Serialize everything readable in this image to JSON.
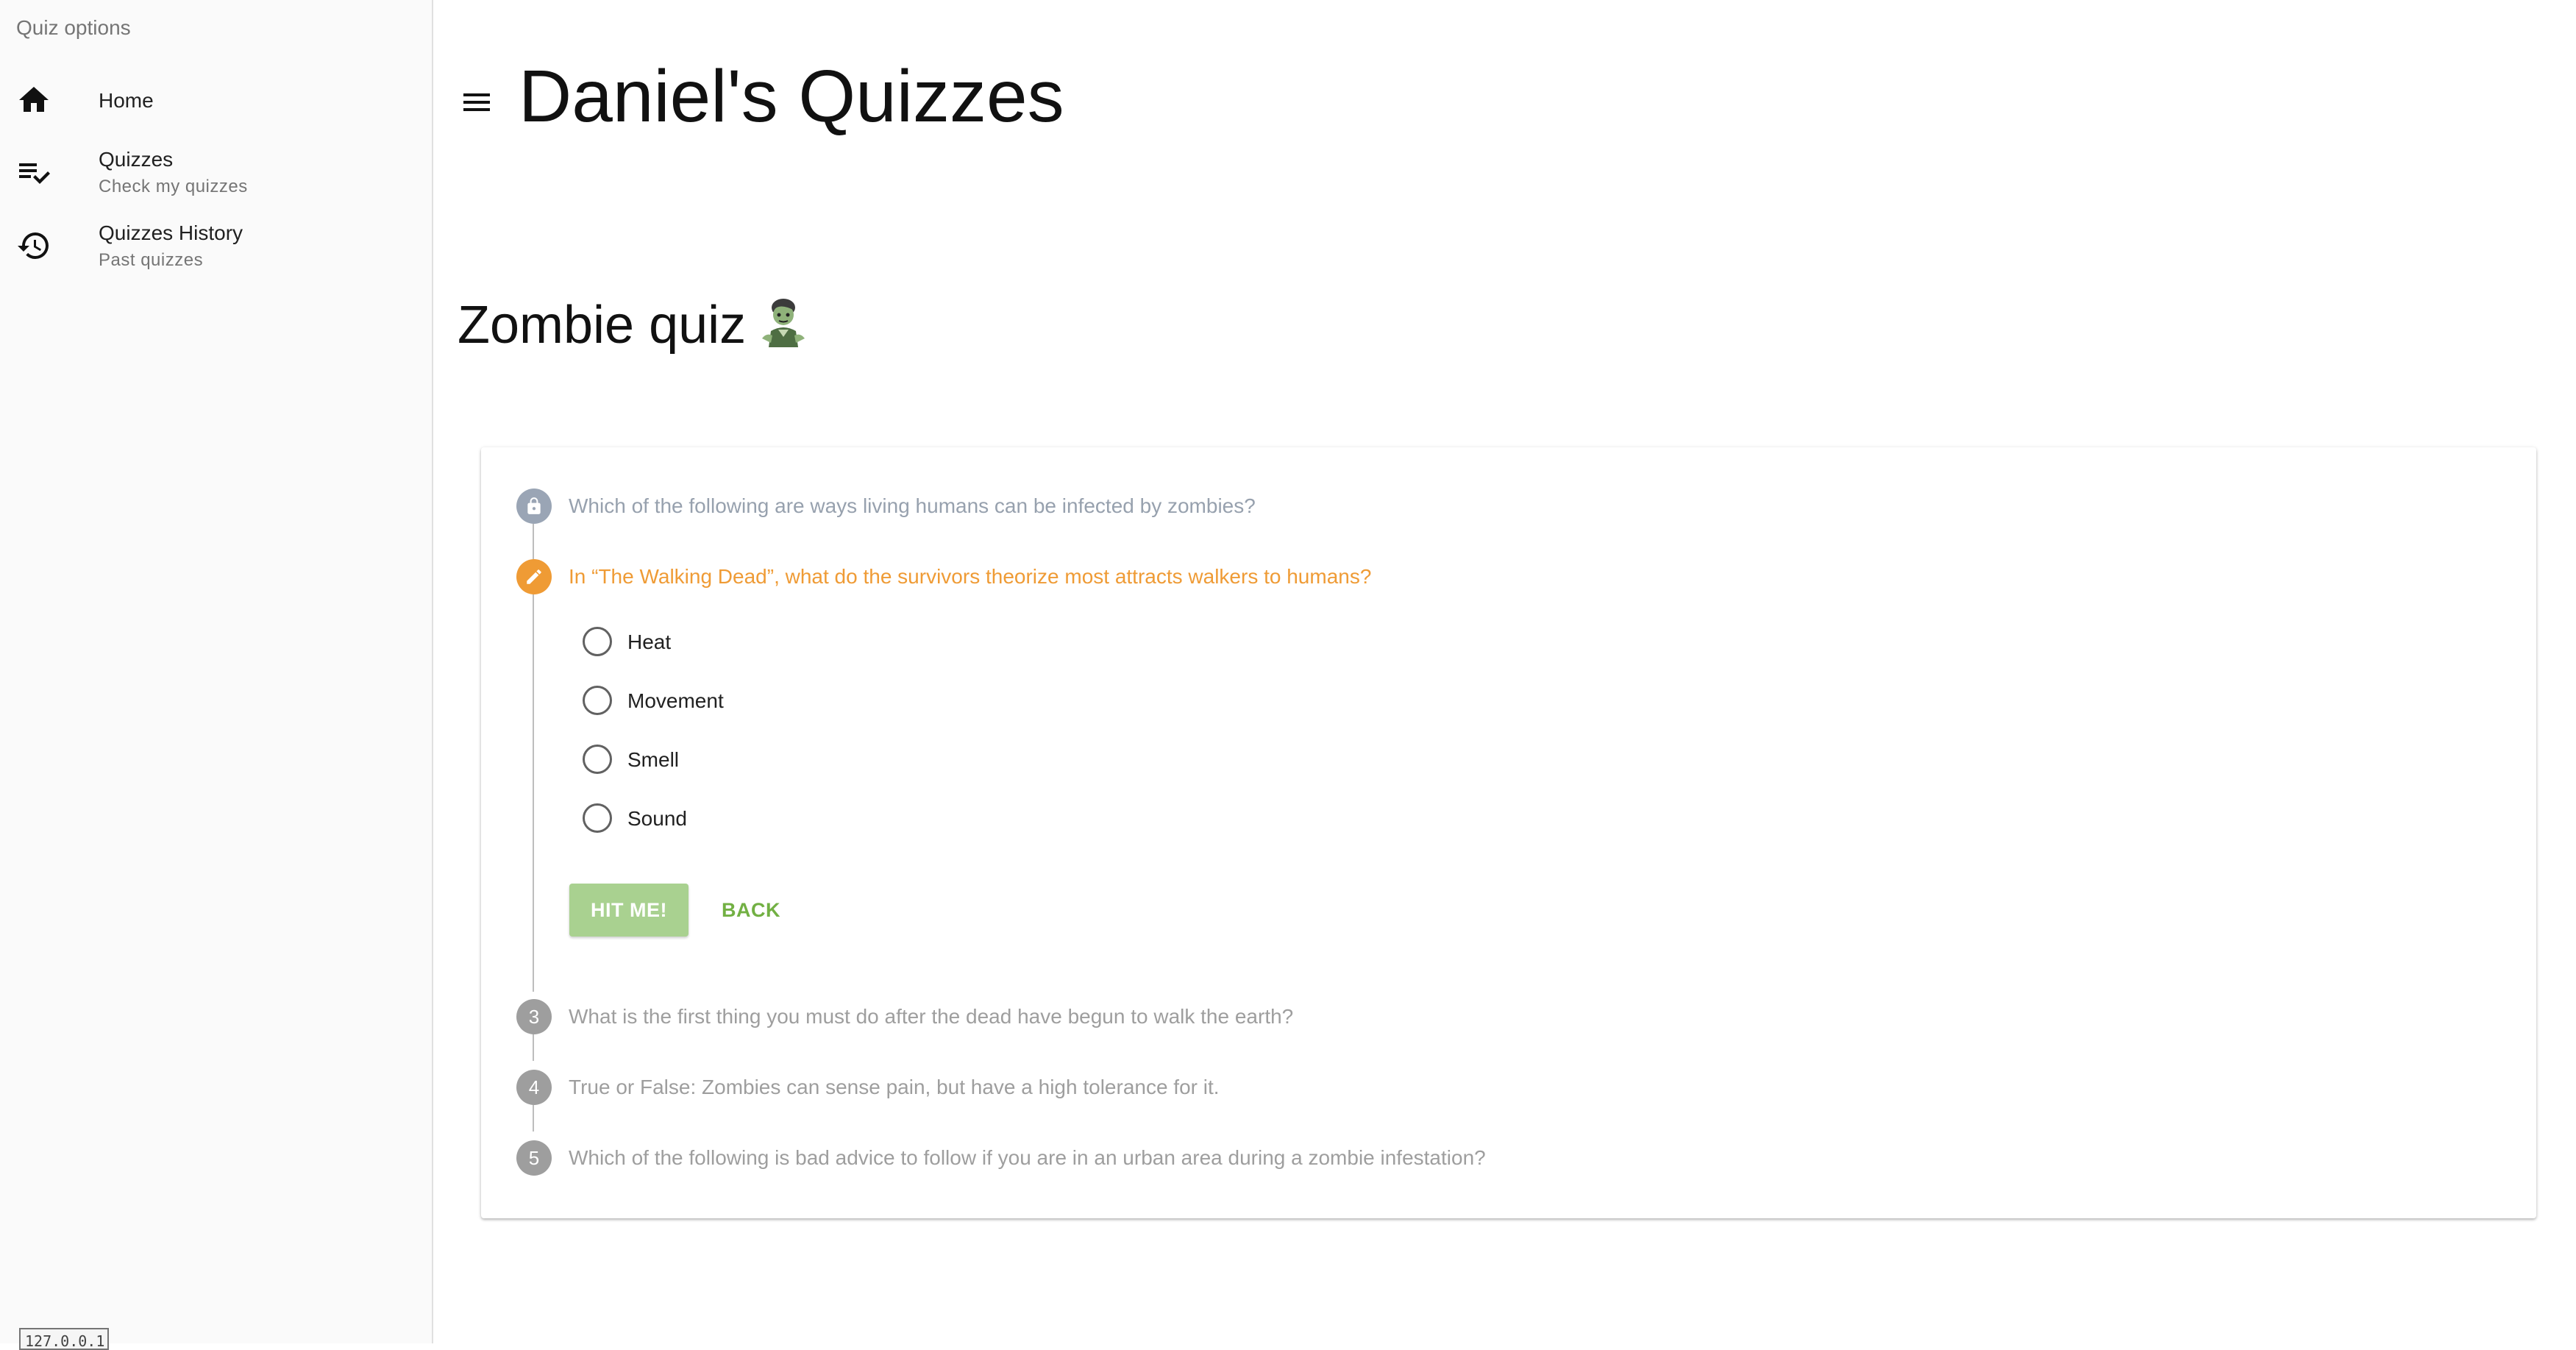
{
  "sidebar": {
    "header": "Quiz options",
    "items": [
      {
        "icon": "home-icon",
        "title": "Home",
        "subtitle": ""
      },
      {
        "icon": "playlist-check-icon",
        "title": "Quizzes",
        "subtitle": "Check my quizzes"
      },
      {
        "icon": "history-icon",
        "title": "Quizzes History",
        "subtitle": "Past quizzes"
      }
    ],
    "ip_badge": "127.0.0.1"
  },
  "header": {
    "title": "Daniel's Quizzes",
    "menu_icon": "menu-icon"
  },
  "quiz": {
    "title": "Zombie quiz",
    "title_icon": "zombie-emoji",
    "steps": [
      {
        "indicator": "lock-icon",
        "state": "locked",
        "question": "Which of the following are ways living humans can be infected by zombies?"
      },
      {
        "indicator": "pencil-icon",
        "state": "active",
        "question": "In “The Walking Dead”, what do the survivors theorize most attracts walkers to humans?"
      },
      {
        "indicator": "3",
        "state": "pending",
        "question": "What is the first thing you must do after the dead have begun to walk the earth?"
      },
      {
        "indicator": "4",
        "state": "pending",
        "question": "True or False: Zombies can sense pain, but have a high tolerance for it."
      },
      {
        "indicator": "5",
        "state": "pending",
        "question": "Which of the following is bad advice to follow if you are in an urban area during a zombie infestation?"
      }
    ],
    "options": [
      "Heat",
      "Movement",
      "Smell",
      "Sound"
    ],
    "submit_label": "HIT ME!",
    "back_label": "BACK"
  },
  "colors": {
    "active": "#ef9b35",
    "locked": "#9aa5b5",
    "pending": "#9e9e9e",
    "primary_button": "#a9d190",
    "back_button_text": "#72b043"
  }
}
